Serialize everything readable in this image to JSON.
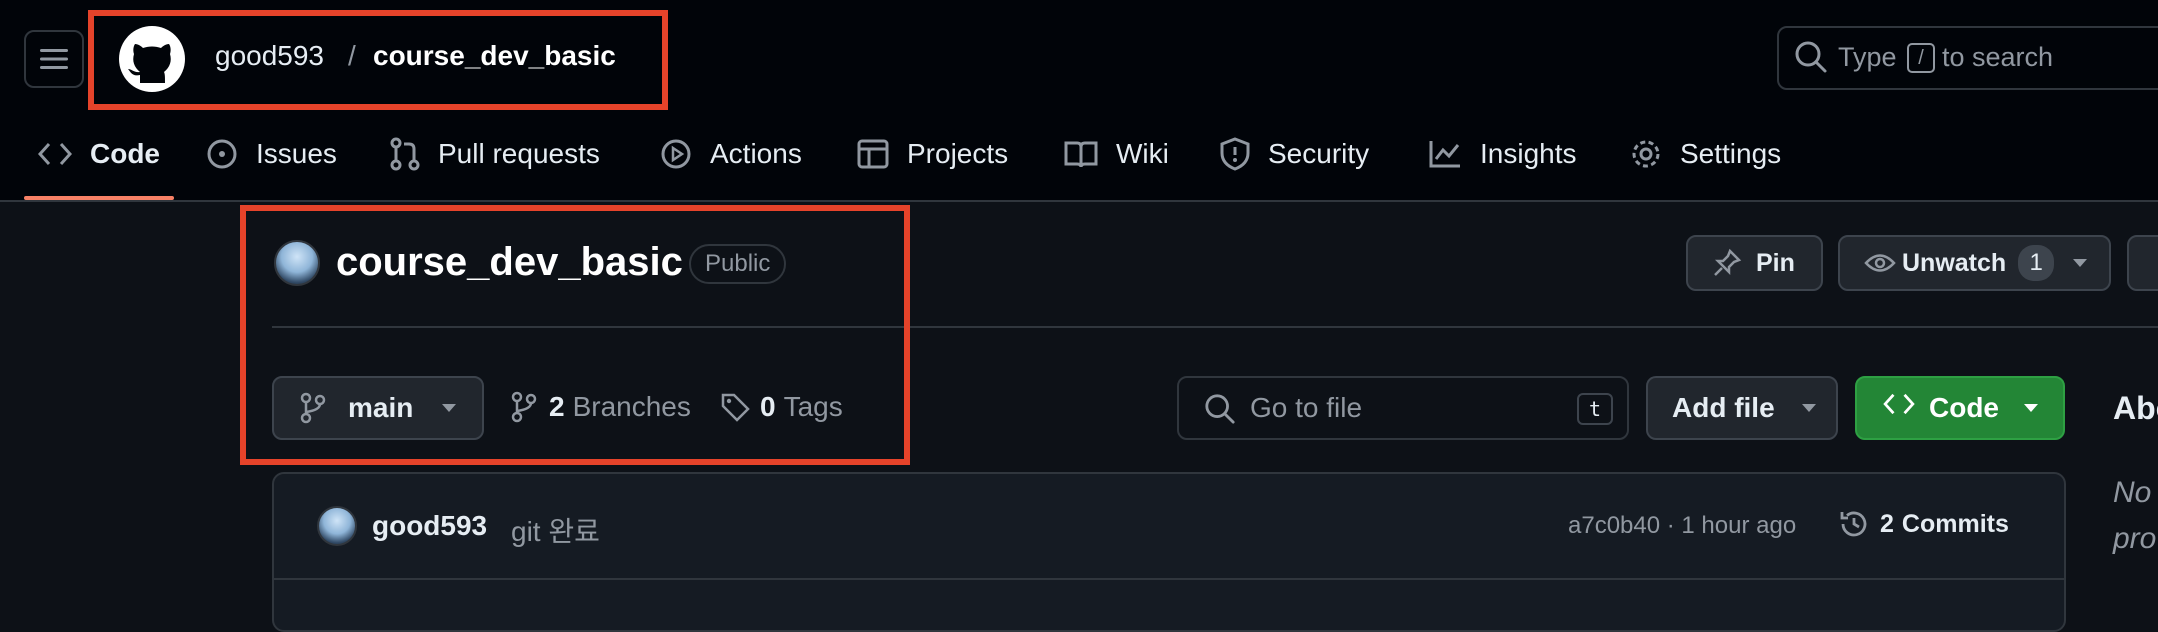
{
  "header": {
    "owner": "good593",
    "separator": "/",
    "repo": "course_dev_basic",
    "search_prefix": "Type",
    "search_key": "/",
    "search_suffix": "to search"
  },
  "nav": {
    "tabs": [
      {
        "label": "Code",
        "icon": "code-icon",
        "active": true
      },
      {
        "label": "Issues",
        "icon": "issue-icon"
      },
      {
        "label": "Pull requests",
        "icon": "pull-request-icon"
      },
      {
        "label": "Actions",
        "icon": "play-icon"
      },
      {
        "label": "Projects",
        "icon": "table-icon"
      },
      {
        "label": "Wiki",
        "icon": "book-icon"
      },
      {
        "label": "Security",
        "icon": "shield-icon"
      },
      {
        "label": "Insights",
        "icon": "graph-icon"
      },
      {
        "label": "Settings",
        "icon": "gear-icon"
      }
    ]
  },
  "repo": {
    "title": "course_dev_basic",
    "visibility": "Public",
    "pin_label": "Pin",
    "unwatch_label": "Unwatch",
    "watch_count": "1"
  },
  "branch_bar": {
    "branch": "main",
    "branches_count": "2",
    "branches_label": "Branches",
    "tags_count": "0",
    "tags_label": "Tags",
    "go_to_file_placeholder": "Go to file",
    "go_to_file_key": "t",
    "add_file_label": "Add file",
    "code_label": "Code"
  },
  "about": {
    "title": "Abo",
    "desc_line1": "No",
    "desc_line2": "pro"
  },
  "latest_commit": {
    "author": "good593",
    "message": "git 완료",
    "sha_time": "a7c0b40 · 1 hour ago",
    "commits_count": "2",
    "commits_label": "Commits"
  },
  "colors": {
    "background": "#0d1117",
    "header_bg": "#010409",
    "accent_underline": "#f78166",
    "code_button": "#238636",
    "annotation_box": "#e5432a"
  }
}
